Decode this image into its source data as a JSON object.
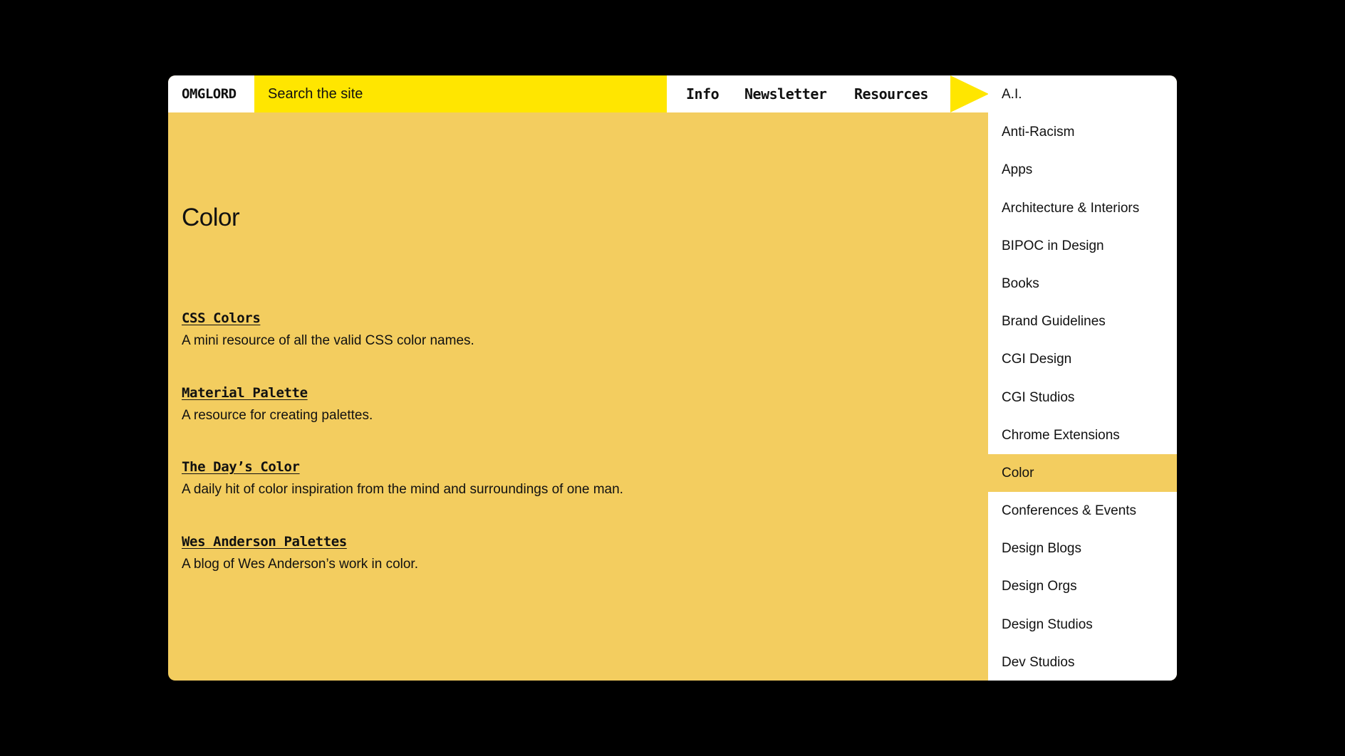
{
  "header": {
    "logo": "OMGLORD",
    "search_placeholder": "Search the site",
    "nav": [
      "Info",
      "Newsletter",
      "Resources"
    ],
    "arrow_icon": "triangle-right-icon"
  },
  "main": {
    "title": "Color",
    "resources": [
      {
        "name": "CSS Colors",
        "description": "A mini resource of all the valid CSS color names."
      },
      {
        "name": "Material Palette",
        "description": "A resource for creating palettes."
      },
      {
        "name": "The Day’s Color",
        "description": "A daily hit of color inspiration from the mind and surroundings of one man."
      },
      {
        "name": "Wes Anderson Palettes",
        "description": "A blog of Wes Anderson’s work in color."
      }
    ]
  },
  "sidebar": {
    "active": "Color",
    "items": [
      "A.I.",
      "Anti-Racism",
      "Apps",
      "Architecture & Interiors",
      "BIPOC in Design",
      "Books",
      "Brand Guidelines",
      "CGI Design",
      "CGI Studios",
      "Chrome Extensions",
      "Color",
      "Conferences & Events",
      "Design Blogs",
      "Design Orgs",
      "Design Studios",
      "Dev Studios"
    ]
  },
  "colors": {
    "background": "#000000",
    "page": "#f3cd5f",
    "search": "#ffe600",
    "panel": "#ffffff",
    "text": "#111111"
  }
}
